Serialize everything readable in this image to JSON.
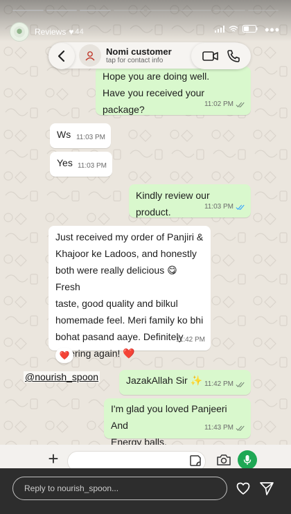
{
  "story": {
    "title": "Reviews",
    "time": "44",
    "progress_total": 8,
    "progress_current": 3,
    "mention": "@nourish_spoon",
    "reply_placeholder": "Reply to nourish_spoon..."
  },
  "chat": {
    "contact_name": "Nomi customer",
    "contact_sub": "tap for contact info",
    "messages": [
      {
        "dir": "out",
        "text": "Hope you are doing well.\nHave you received your package?",
        "time": "11:02 PM",
        "ticks": "read"
      },
      {
        "dir": "in",
        "text": "Ws",
        "time": "11:03 PM"
      },
      {
        "dir": "in",
        "text": "Yes",
        "time": "11:03 PM"
      },
      {
        "dir": "out",
        "text": "Kindly review our product.",
        "time": "11:03 PM",
        "ticks": "read-blue"
      },
      {
        "dir": "in",
        "text": "Just received my order of Panjiri &\nKhajoor ke Ladoos, and honestly\nboth were really delicious 😋 Fresh\ntaste, good quality and bilkul\nhomemade feel. Meri family ko bhi\nbohat pasand aaye. Definitely\nordering again! ❤️",
        "time": "11:42 PM"
      },
      {
        "dir": "out",
        "text": "JazakAllah Sir ✨",
        "time": "11:42 PM",
        "ticks": "read"
      },
      {
        "dir": "out",
        "text": "I'm glad you loved Panjeeri And\nEnergy balls.",
        "time": "11:43 PM",
        "ticks": "read"
      }
    ],
    "reaction": "❤️"
  },
  "icons": {
    "back": "chevron-left-icon",
    "video": "video-call-icon",
    "call": "phone-icon",
    "plus": "plus-icon",
    "sticker": "sticker-icon",
    "camera": "camera-icon",
    "mic": "microphone-icon",
    "heart": "heart-icon",
    "send": "send-icon"
  },
  "colors": {
    "outgoing_bubble": "#d9f8cd",
    "incoming_bubble": "#ffffff",
    "wallpaper": "#ebe6de",
    "mic_green": "#1fa855",
    "read_blue": "#34a3ff"
  }
}
